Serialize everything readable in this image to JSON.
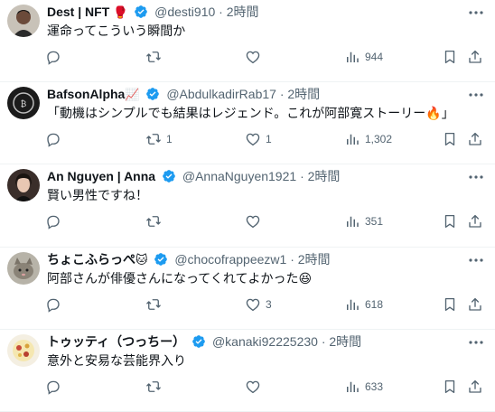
{
  "tweets": [
    {
      "name": "Dest | NFT",
      "name_emoji": "🥊",
      "handle": "@desti910",
      "sep": "·",
      "time": "2時間",
      "text": "運命ってこういう瞬間か",
      "replies": "",
      "retweets": "",
      "likes": "",
      "views": "944",
      "avatar_icon": "avatar-dest-icon"
    },
    {
      "name": "BafsonAlpha",
      "name_emoji": "📈",
      "handle": "@AbdulkadirRab17",
      "sep": "·",
      "time": "2時間",
      "text": "「動機はシンプルでも結果はレジェンド。これが阿部寛ストーリー🔥」",
      "replies": "",
      "retweets": "1",
      "likes": "1",
      "views": "1,302",
      "avatar_icon": "avatar-bafson-icon"
    },
    {
      "name": "An Nguyen | Anna",
      "name_emoji": "",
      "handle": "@AnnaNguyen1921",
      "sep": "·",
      "time": "2時間",
      "text": "賢い男性ですね！",
      "replies": "",
      "retweets": "",
      "likes": "",
      "views": "351",
      "avatar_icon": "avatar-anna-icon"
    },
    {
      "name": "ちょこふらっぺ",
      "name_emoji": "🐱",
      "handle": "@chocofrappeezw1",
      "sep": "·",
      "time": "2時間",
      "text": "阿部さんが俳優さんになってくれてよかった😆",
      "replies": "",
      "retweets": "",
      "likes": "3",
      "views": "618",
      "avatar_icon": "avatar-choco-icon"
    },
    {
      "name": "トゥッティ（つっちー）",
      "name_emoji": "",
      "handle": "@kanaki92225230",
      "sep": "·",
      "time": "2時間",
      "text": "意外と安易な芸能界入り",
      "replies": "",
      "retweets": "",
      "likes": "",
      "views": "633",
      "avatar_icon": "avatar-tutti-icon"
    }
  ],
  "colors": {
    "verified": "#1d9bf0",
    "secondary_text": "#536471",
    "divider": "#eff3f4"
  }
}
